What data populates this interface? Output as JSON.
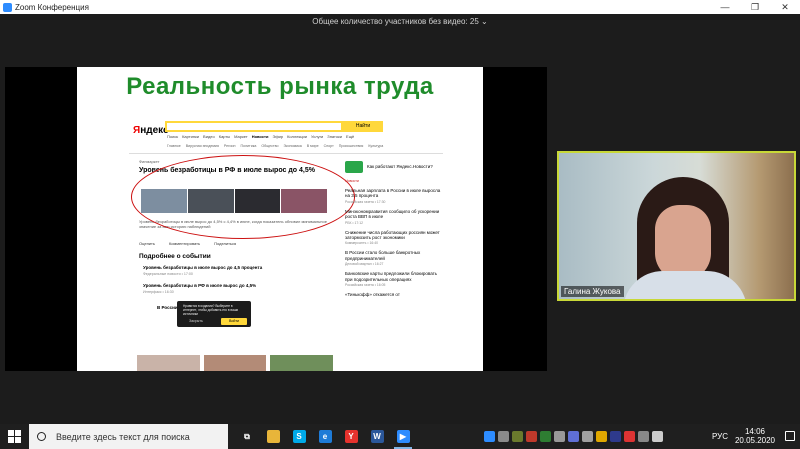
{
  "window": {
    "title": "Zoom Конференция",
    "controls": [
      "—",
      "❐",
      "✕"
    ]
  },
  "meeting": {
    "participants_banner": "Общее количество участников без видео: 25 ⌄"
  },
  "slide": {
    "title": "Реальность рынка труда",
    "screenshot": {
      "logo_red": "Я",
      "logo_rest": "ндекс",
      "search_button": "Найти",
      "nav": [
        "Поиск",
        "Картинки",
        "Видео",
        "Карты",
        "Маркет",
        "Новости",
        "Эфир",
        "Коллекции",
        "Услуги",
        "Знатоки",
        "Ещё"
      ],
      "categories": [
        "Главное",
        "Вирусная эпидемия",
        "Регион",
        "Политика",
        "Общество",
        "Экономика",
        "В мире",
        "Спорт",
        "Происшествия",
        "Культура"
      ],
      "news_source": "Финмаркет",
      "headline": "Уровень безработицы в РФ в июле вырос до 4,5%",
      "body": "Уровень безработицы в июле вырос до 4,5% с 4,4% в июне, когда показатель обновил минимальное значение за всю историю наблюдений",
      "actions": [
        "Оценить",
        "Комментировать",
        "Поделиться"
      ],
      "related_title": "Подробнее о событии",
      "related": [
        {
          "title": "Уровень безработицы в июле вырос до 4,5 процента",
          "meta": "Федеральные новости • 17:00"
        },
        {
          "title": "Уровень безработицы в РФ в июле вырос до 4,5%",
          "meta": "Интерфакс • 16:30"
        },
        {
          "title": "В России",
          "meta": ""
        }
      ],
      "popup": {
        "text": "Нравится в издании? Выберите в интернет, чтобы добавить его в ваши источники",
        "close": "Закрыть",
        "ok": "Войти"
      },
      "right": {
        "promo": "Как работают Яндекс.Новости?",
        "label": "Новости",
        "items": [
          {
            "title": "Реальная зарплата в России в июле выросла на 3,5 процента",
            "meta": "Российская газета • 17:30"
          },
          {
            "title": "Минэкономразвития сообщило об ускорении роста ВВП в июле",
            "meta": "РБК • 17:12"
          },
          {
            "title": "Снижение числа работающих россиян может затормозить рост экономики",
            "meta": "Коммерсантъ • 16:40"
          },
          {
            "title": "В России стало больше банкротных предпринимателей",
            "meta": "Деловой квартал • 16:27"
          },
          {
            "title": "Банковские карты предложили блокировать при подозрительных операциях",
            "meta": "Российская газета • 16:05"
          },
          {
            "title": "«Тинькофф» откажется от",
            "meta": ""
          }
        ]
      }
    }
  },
  "video": {
    "participant_name": "Галина Жукова"
  },
  "taskbar": {
    "search_placeholder": "Введите здесь текст для поиска",
    "language": "РУС",
    "time": "14:06",
    "date": "20.05.2020",
    "apps": [
      {
        "icon": "task-view-icon",
        "glyph": "⧉",
        "color": "#1f1f1f"
      },
      {
        "icon": "file-explorer-icon",
        "glyph": "",
        "color": "#e8b53a"
      },
      {
        "icon": "skype-icon",
        "glyph": "S",
        "color": "#00a9e8"
      },
      {
        "icon": "edge-icon",
        "glyph": "e",
        "color": "#1e7bd7"
      },
      {
        "icon": "yandex-browser-icon",
        "glyph": "Y",
        "color": "#e6322d"
      },
      {
        "icon": "word-icon",
        "glyph": "W",
        "color": "#2b579a"
      },
      {
        "icon": "zoom-icon",
        "glyph": "▶",
        "color": "#2d8cff"
      }
    ],
    "tray_colors": [
      "#2d8cff",
      "#8a8a8a",
      "#6b7a2d",
      "#c0392b",
      "#2e7d32",
      "#999999",
      "#5f6fd4",
      "#a0a0a0",
      "#e0a800",
      "#2e3a8c",
      "#d33",
      "#888888",
      "#cccccc"
    ]
  }
}
